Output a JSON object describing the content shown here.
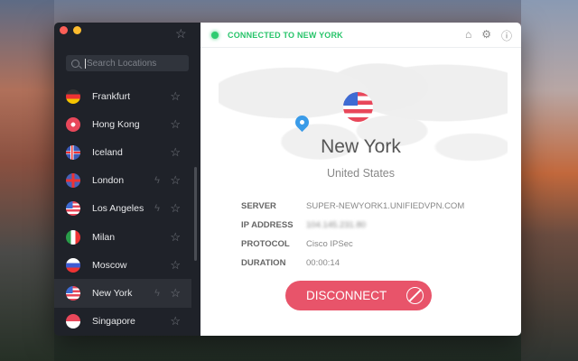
{
  "header": {
    "status": "CONNECTED TO NEW YORK",
    "status_color": "#27c46a",
    "icons": [
      "home-icon",
      "gear-icon",
      "help-icon"
    ]
  },
  "sidebar": {
    "search_placeholder": "Search Locations",
    "items": [
      {
        "label": "Frankfurt",
        "flag": "de",
        "bolt": false
      },
      {
        "label": "Hong Kong",
        "flag": "hk",
        "bolt": false
      },
      {
        "label": "Iceland",
        "flag": "is",
        "bolt": false
      },
      {
        "label": "London",
        "flag": "gb",
        "bolt": true
      },
      {
        "label": "Los Angeles",
        "flag": "us",
        "bolt": true
      },
      {
        "label": "Milan",
        "flag": "it",
        "bolt": false
      },
      {
        "label": "Moscow",
        "flag": "ru",
        "bolt": false
      },
      {
        "label": "New York",
        "flag": "us",
        "bolt": true,
        "selected": true
      },
      {
        "label": "Singapore",
        "flag": "sg",
        "bolt": false
      }
    ]
  },
  "location": {
    "city": "New York",
    "country": "United States"
  },
  "details": [
    {
      "label": "SERVER",
      "value": "SUPER-NEWYORK1.UNIFIEDVPN.COM"
    },
    {
      "label": "IP ADDRESS",
      "value": "104.145.231.80"
    },
    {
      "label": "PROTOCOL",
      "value": "Cisco IPSec"
    },
    {
      "label": "DURATION",
      "value": "00:00:14"
    }
  ],
  "disconnect_label": "DISCONNECT",
  "accent": "#e8546a"
}
